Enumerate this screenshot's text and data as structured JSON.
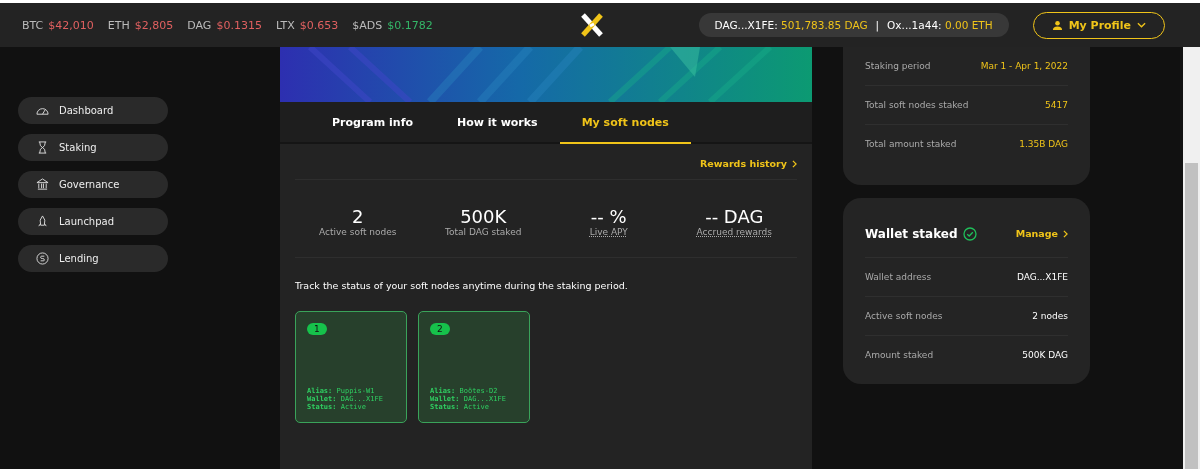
{
  "ticker": [
    {
      "symbol": "BTC",
      "price": "$42,010",
      "color": "#e06060"
    },
    {
      "symbol": "ETH",
      "price": "$2,805",
      "color": "#e06060"
    },
    {
      "symbol": "DAG",
      "price": "$0.1315",
      "color": "#e06060"
    },
    {
      "symbol": "LTX",
      "price": "$0.653",
      "color": "#e06060"
    },
    {
      "symbol": "$ADS",
      "price": "$0.1782",
      "color": "#34b768"
    }
  ],
  "wallet_pill": {
    "dag_address": "DAG...X1FE:",
    "dag_balance": "501,783.85 DAG",
    "separator": "|",
    "eth_address": "Ox...1a44:",
    "eth_balance": "0.00 ETH"
  },
  "profile_button": {
    "label": "My Profile"
  },
  "sidebar": {
    "items": [
      {
        "label": "Dashboard"
      },
      {
        "label": "Staking"
      },
      {
        "label": "Governance"
      },
      {
        "label": "Launchpad"
      },
      {
        "label": "Lending"
      }
    ]
  },
  "tabs": [
    {
      "label": "Program info",
      "selected": false
    },
    {
      "label": "How it works",
      "selected": false
    },
    {
      "label": "My soft nodes",
      "selected": true
    }
  ],
  "rewards_link": "Rewards history",
  "stats": [
    {
      "value": "2",
      "label": "Active soft nodes",
      "underlined": false
    },
    {
      "value": "500K",
      "label": "Total DAG staked",
      "underlined": false
    },
    {
      "value": "-- %",
      "label": "Live APY",
      "underlined": true
    },
    {
      "value": "-- DAG",
      "label": "Accrued rewards",
      "underlined": true
    }
  ],
  "track_text": "Track the status of your soft nodes anytime during the staking period.",
  "nodes": [
    {
      "number": "1",
      "lines": [
        "**Alias:** Puppis-W1",
        "**Wallet:** DAG...X1FE",
        "**Status:** Active"
      ]
    },
    {
      "number": "2",
      "lines": [
        "**Alias:** Boötes-D2",
        "**Wallet:** DAG...X1FE",
        "**Status:** Active"
      ]
    }
  ],
  "program_card": {
    "rows": [
      {
        "label": "Staking period",
        "value": "Mar 1 - Apr 1, 2022"
      },
      {
        "label": "Total soft nodes staked",
        "value": "5417"
      },
      {
        "label": "Total amount staked",
        "value": "1.35B DAG"
      }
    ]
  },
  "wallet_card": {
    "title": "Wallet staked",
    "verified": true,
    "action": "Manage",
    "rows": [
      {
        "label": "Wallet address",
        "value": "DAG...X1FE"
      },
      {
        "label": "Active soft nodes",
        "value": "2 nodes"
      },
      {
        "label": "Amount staked",
        "value": "500K DAG"
      }
    ]
  }
}
